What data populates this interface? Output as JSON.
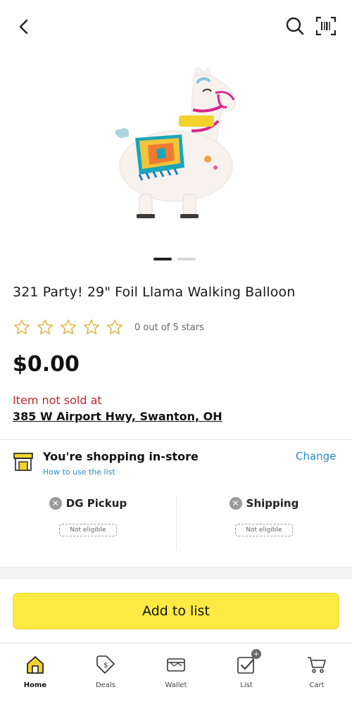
{
  "header": {
    "back_icon": "chevron-left-icon",
    "search_icon": "search-icon",
    "scan_icon": "barcode-scan-icon"
  },
  "product": {
    "title": "321 Party! 29\" Foil Llama Walking Balloon",
    "rating_value": 0,
    "rating_max": 5,
    "rating_text": "0 out of 5 stars",
    "price": "$0.00",
    "image_slides": 2,
    "active_slide": 1
  },
  "availability": {
    "not_sold_text": "Item not sold at",
    "address": "385 W Airport Hwy, Swanton, OH"
  },
  "shopping_mode": {
    "title": "You're shopping in-store",
    "help_link": "How to use the list",
    "change_link": "Change"
  },
  "fulfillment": [
    {
      "label": "DG Pickup",
      "status": "Not eligible"
    },
    {
      "label": "Shipping",
      "status": "Not eligible"
    }
  ],
  "actions": {
    "add_to_list": "Add to list"
  },
  "tabbar": {
    "items": [
      {
        "label": "Home",
        "icon": "home-icon",
        "active": true
      },
      {
        "label": "Deals",
        "icon": "tag-icon",
        "active": false
      },
      {
        "label": "Wallet",
        "icon": "wallet-icon",
        "active": false
      },
      {
        "label": "List",
        "icon": "list-check-icon",
        "active": false,
        "badge": "+"
      },
      {
        "label": "Cart",
        "icon": "cart-icon",
        "active": false
      }
    ]
  },
  "colors": {
    "accent_yellow": "#fdeb43",
    "link_blue": "#2a8ac9",
    "error_red": "#c0262d",
    "star_outline": "#e1b84a"
  }
}
